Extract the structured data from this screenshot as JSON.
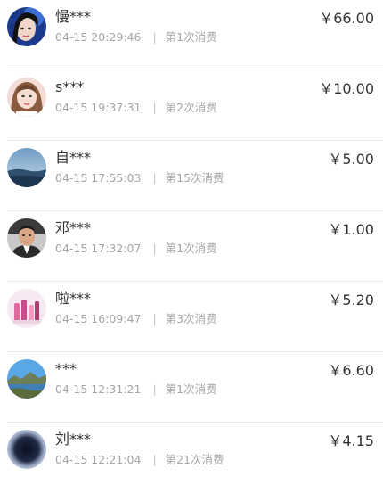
{
  "records": [
    {
      "name": "慢***",
      "time": "04-15 20:29:46",
      "separator": "|",
      "visit": "第1次消费",
      "amount": "￥66.00",
      "avatar_icon": "woman-portrait-avatar"
    },
    {
      "name": "s***",
      "time": "04-15 19:37:31",
      "separator": "|",
      "visit": "第2次消费",
      "amount": "￥10.00",
      "avatar_icon": "woman-portrait-avatar"
    },
    {
      "name": "自***",
      "time": "04-15 17:55:03",
      "separator": "|",
      "visit": "第15次消费",
      "amount": "￥5.00",
      "avatar_icon": "sea-landscape-avatar"
    },
    {
      "name": "邓***",
      "time": "04-15 17:32:07",
      "separator": "|",
      "visit": "第1次消费",
      "amount": "￥1.00",
      "avatar_icon": "man-portrait-avatar"
    },
    {
      "name": "啦***",
      "time": "04-15 16:09:47",
      "separator": "|",
      "visit": "第3次消费",
      "amount": "￥5.20",
      "avatar_icon": "cosmetics-avatar"
    },
    {
      "name": "***",
      "time": "04-15 12:31:21",
      "separator": "|",
      "visit": "第1次消费",
      "amount": "￥6.60",
      "avatar_icon": "lake-landscape-avatar"
    },
    {
      "name": "刘***",
      "time": "04-15 12:21:04",
      "separator": "|",
      "visit": "第21次消费",
      "amount": "￥4.15",
      "avatar_icon": "dark-orb-avatar"
    }
  ]
}
